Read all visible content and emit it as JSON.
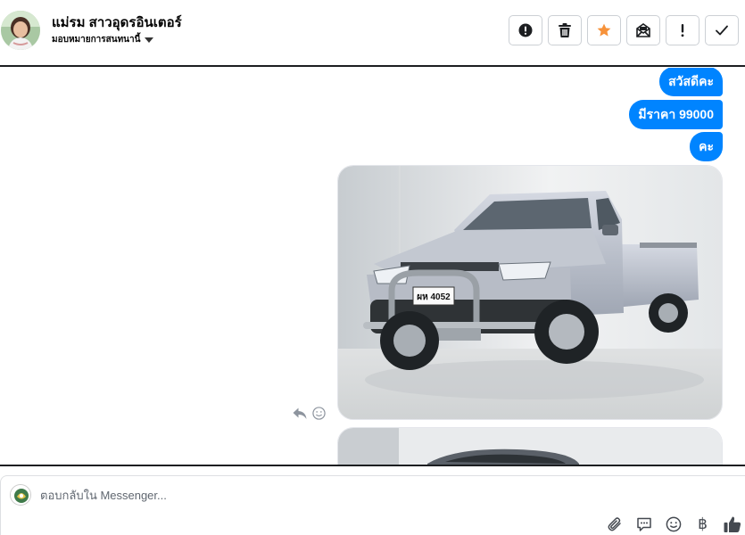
{
  "header": {
    "contact_name": "แม่รม สาวอุดรอินเตอร์",
    "assign_label": "มอบหมายการสนทนานี้"
  },
  "toolbar": {
    "buttons": [
      {
        "name": "mark-spam-button",
        "icon": "alert-circle-icon"
      },
      {
        "name": "delete-button",
        "icon": "trash-icon"
      },
      {
        "name": "star-button",
        "icon": "star-icon"
      },
      {
        "name": "mark-unread-button",
        "icon": "envelope-icon"
      },
      {
        "name": "follow-up-button",
        "icon": "exclamation-icon"
      },
      {
        "name": "mark-done-button",
        "icon": "check-icon"
      }
    ],
    "star_color": "#f7923a"
  },
  "messages": [
    {
      "text": "สวัสดีคะ"
    },
    {
      "text": "มีราคา 99000"
    },
    {
      "text": "คะ"
    }
  ],
  "attachment": {
    "plate_text": "ผห 4052"
  },
  "composer": {
    "placeholder": "ตอบกลับใน Messenger...",
    "baht_symbol": "฿"
  },
  "colors": {
    "bubble": "#0084ff",
    "divider": "#1c1e21"
  }
}
